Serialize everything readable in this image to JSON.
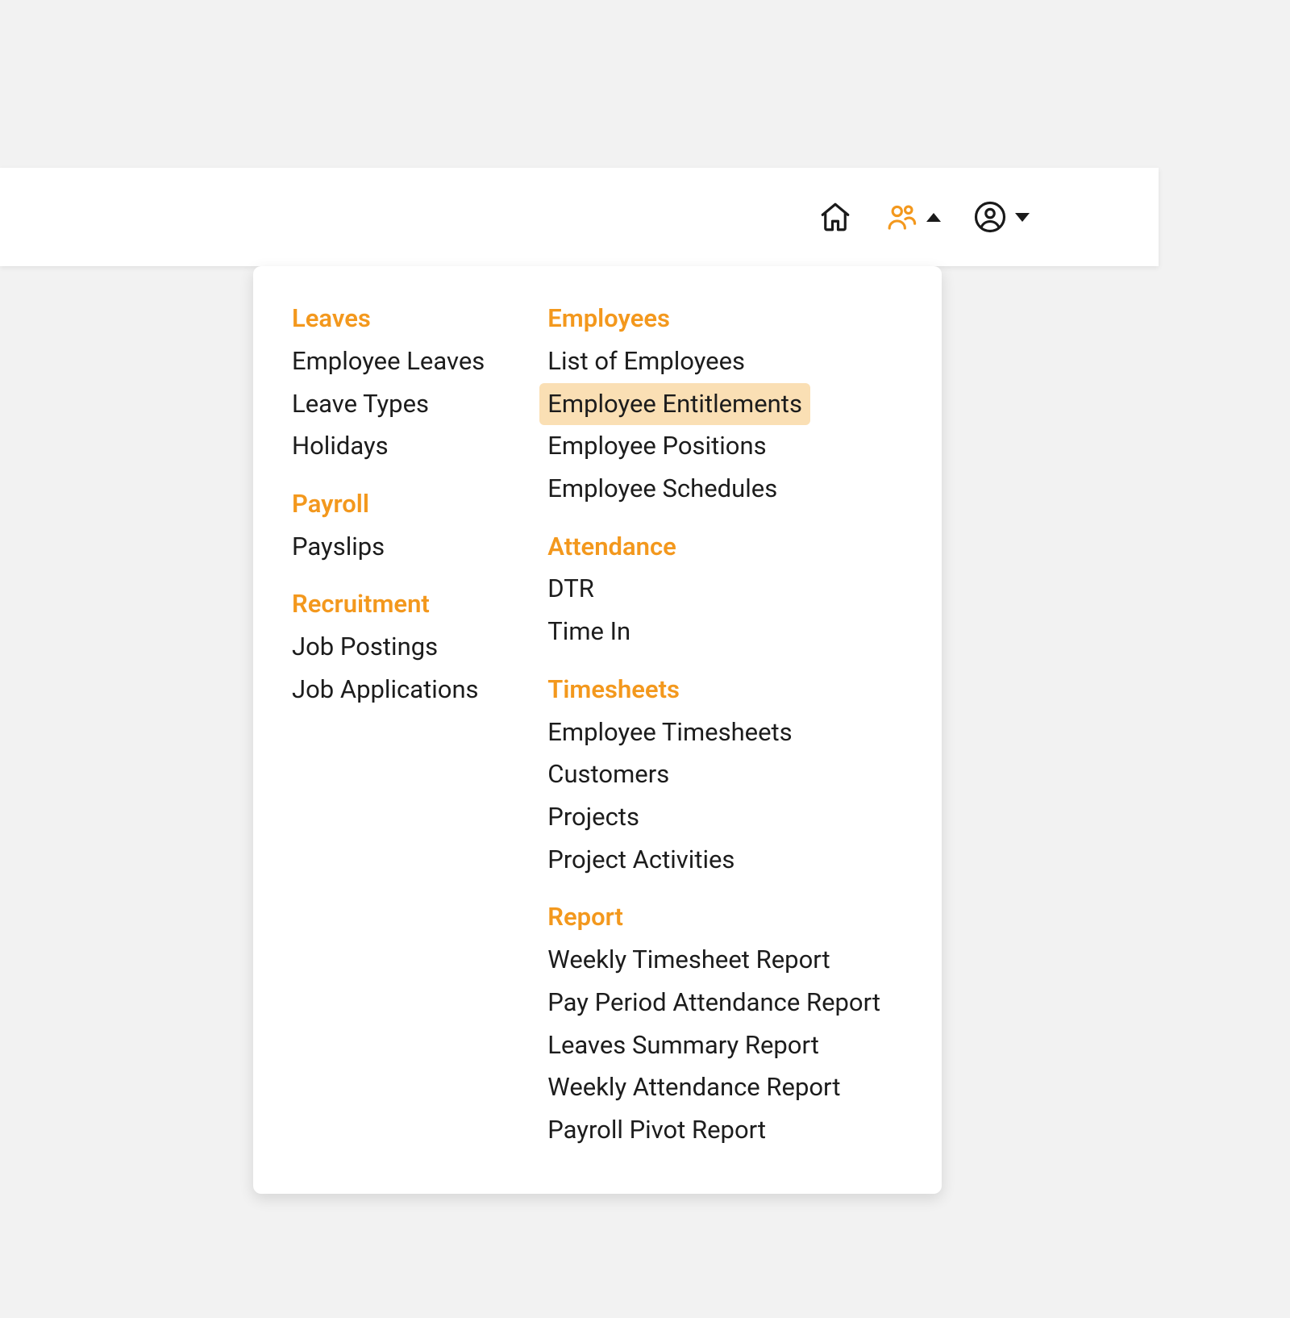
{
  "topbar": {
    "home_icon": "home",
    "people_icon": "people",
    "account_icon": "account",
    "people_active": true
  },
  "accent_color": "#f3981d",
  "highlight_bg": "#fadfb4",
  "menu": {
    "col1": [
      {
        "title": "Leaves",
        "items": [
          "Employee Leaves",
          "Leave Types",
          "Holidays"
        ]
      },
      {
        "title": "Payroll",
        "items": [
          "Payslips"
        ]
      },
      {
        "title": "Recruitment",
        "items": [
          "Job Postings",
          "Job Applications"
        ]
      }
    ],
    "col2": [
      {
        "title": "Employees",
        "items": [
          "List of Employees",
          "Employee Entitlements",
          "Employee Positions",
          "Employee Schedules"
        ],
        "highlighted": "Employee Entitlements"
      },
      {
        "title": "Attendance",
        "items": [
          "DTR",
          "Time In"
        ]
      },
      {
        "title": "Timesheets",
        "items": [
          "Employee Timesheets",
          "Customers",
          "Projects",
          "Project Activities"
        ]
      },
      {
        "title": "Report",
        "items": [
          "Weekly Timesheet Report",
          "Pay Period Attendance Report",
          "Leaves Summary Report",
          "Weekly Attendance Report",
          "Payroll Pivot Report"
        ]
      }
    ]
  }
}
